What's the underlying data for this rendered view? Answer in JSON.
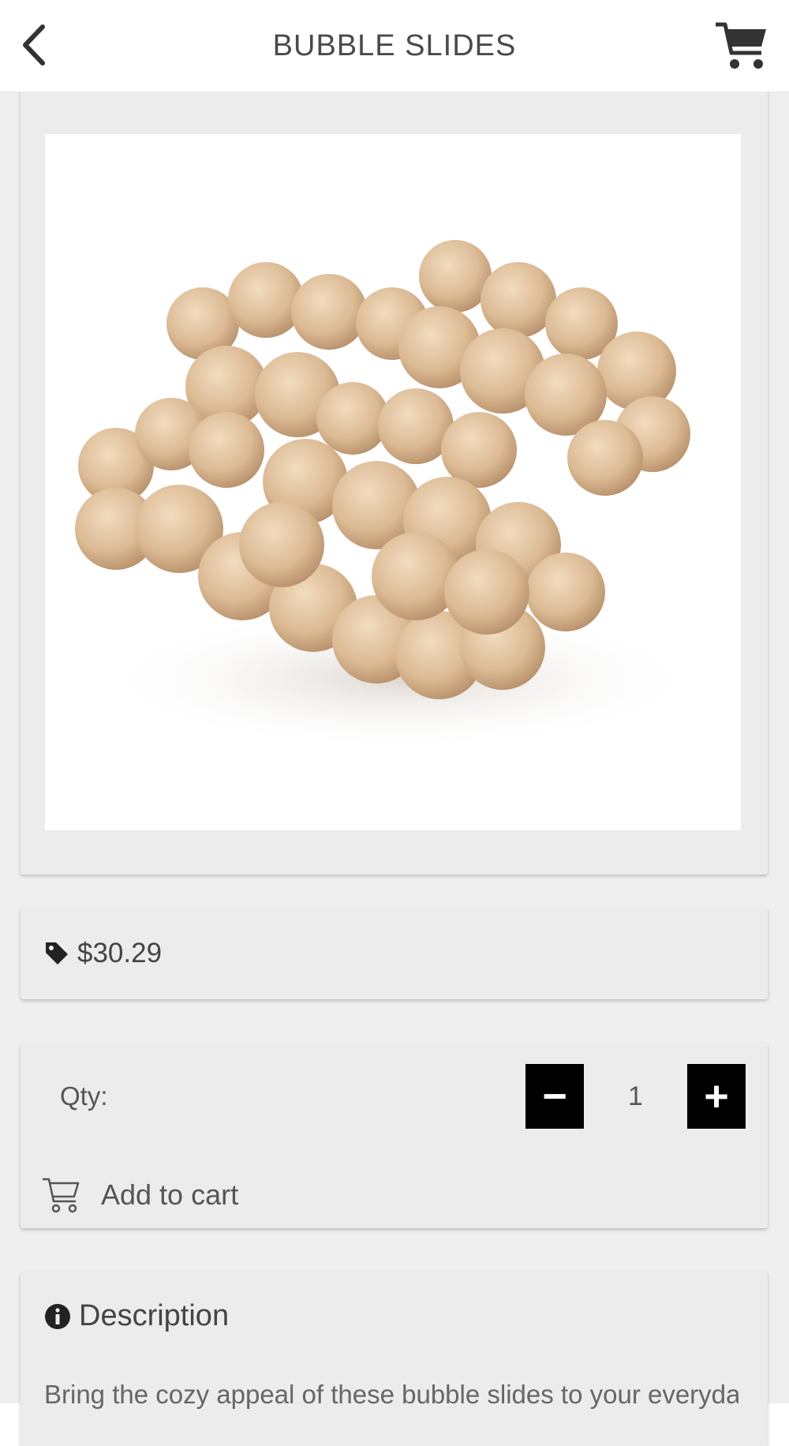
{
  "header": {
    "title": "BUBBLE SLIDES",
    "back_icon": "chevron-left-icon",
    "cart_icon": "shopping-cart-icon"
  },
  "product": {
    "image_alt": "Bubble slides product photo",
    "price": "$30.29",
    "price_icon": "tag-icon"
  },
  "quantity": {
    "label": "Qty:",
    "value": "1",
    "minus_label": "−",
    "plus_label": "+"
  },
  "add_to_cart": {
    "label": "Add to cart",
    "icon": "cart-outline-icon"
  },
  "description": {
    "title": "Description",
    "icon": "info-circle-icon",
    "text": "Bring the cozy appeal of these bubble slides to your everyday wear"
  },
  "colors": {
    "background": "#efefef",
    "card": "#ececec",
    "header": "#ffffff",
    "stepper": "#000000",
    "slide_tan": "#d9b791"
  }
}
